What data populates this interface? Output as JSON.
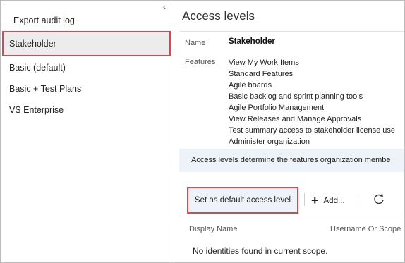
{
  "sidebar": {
    "export_label": "Export audit log",
    "items": [
      {
        "label": "Stakeholder",
        "selected": true
      },
      {
        "label": "Basic (default)"
      },
      {
        "label": "Basic + Test Plans"
      },
      {
        "label": "VS Enterprise"
      }
    ]
  },
  "main": {
    "title": "Access levels",
    "name_label": "Name",
    "name_value": "Stakeholder",
    "features_label": "Features",
    "features": [
      "View My Work Items",
      "Standard Features",
      "Agile boards",
      "Basic backlog and sprint planning tools",
      "Agile Portfolio Management",
      "View Releases and Manage Approvals",
      "Test summary access to stakeholder license use",
      "Administer organization"
    ],
    "info_text": "Access levels determine the features organization membe",
    "toolbar": {
      "default_label": "Set as default access level",
      "add_label": "Add..."
    },
    "columns": {
      "display_name": "Display Name",
      "username": "Username Or Scope"
    },
    "empty_text": "No identities found in current scope."
  },
  "colors": {
    "highlight_border": "#e0434a",
    "selected_bg": "#ececec",
    "info_bg": "#eef3f9"
  }
}
